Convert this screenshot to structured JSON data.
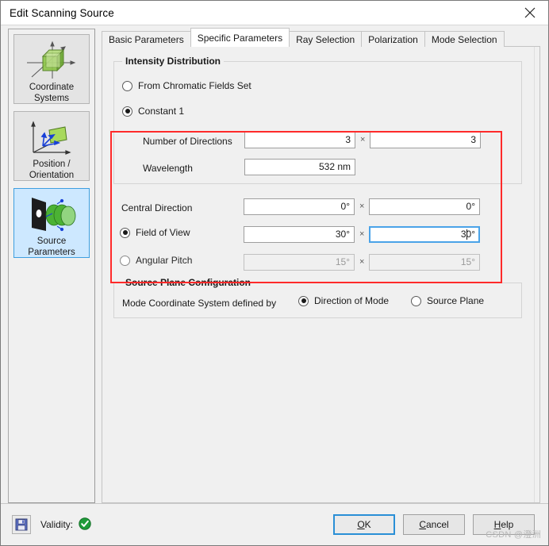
{
  "window": {
    "title": "Edit Scanning Source",
    "close_icon": "close-icon"
  },
  "sidebar": {
    "items": [
      {
        "label_line1": "Coordinate",
        "label_line2": "Systems",
        "icon": "coordinate-systems-icon",
        "selected": false
      },
      {
        "label_line1": "Position /",
        "label_line2": "Orientation",
        "icon": "position-orientation-icon",
        "selected": false
      },
      {
        "label_line1": "Source",
        "label_line2": "Parameters",
        "icon": "source-parameters-icon",
        "selected": true
      }
    ]
  },
  "tabs": [
    {
      "label": "Basic Parameters",
      "active": false
    },
    {
      "label": "Specific Parameters",
      "active": true
    },
    {
      "label": "Ray Selection",
      "active": false
    },
    {
      "label": "Polarization",
      "active": false
    },
    {
      "label": "Mode Selection",
      "active": false
    }
  ],
  "intensity_distribution": {
    "group_title": "Intensity Distribution",
    "option_chromatic": {
      "label": "From Chromatic Fields Set",
      "checked": false
    },
    "option_constant": {
      "label": "Constant 1",
      "checked": true
    },
    "number_of_directions": {
      "label": "Number of Directions",
      "value_x": "3",
      "value_y": "3",
      "separator": "×"
    },
    "wavelength": {
      "label": "Wavelength",
      "value": "532 nm"
    }
  },
  "angles": {
    "central_direction": {
      "label": "Central Direction",
      "value_x": "0°",
      "value_y": "0°",
      "separator": "×"
    },
    "field_of_view": {
      "label": "Field of View",
      "checked": true,
      "value_x": "30°",
      "value_y": "30°",
      "separator": "×",
      "focused_field": "y"
    },
    "angular_pitch": {
      "label": "Angular Pitch",
      "checked": false,
      "disabled": true,
      "value_x": "15°",
      "value_y": "15°",
      "separator": "×"
    }
  },
  "source_plane_configuration": {
    "group_title": "Source Plane Configuration",
    "prompt": "Mode Coordinate System defined by",
    "option_direction_of_mode": {
      "label": "Direction of Mode",
      "checked": true
    },
    "option_source_plane": {
      "label": "Source Plane",
      "checked": false
    }
  },
  "footer": {
    "save_icon": "save-icon",
    "validity_label": "Validity:",
    "validity_icon": "check-circle-icon",
    "ok_label": "OK",
    "ok_accel": "O",
    "cancel_label": "Cancel",
    "cancel_accel": "C",
    "help_label": "Help",
    "help_accel": "H",
    "watermark": "CSDN @澄洲"
  },
  "colors": {
    "annotation_red": "#ff2a2a",
    "focus_blue": "#4aa3e8",
    "selection_blue": "#cde8ff",
    "validity_green": "#1f9c3a",
    "panel_gray": "#f0f0f0"
  }
}
